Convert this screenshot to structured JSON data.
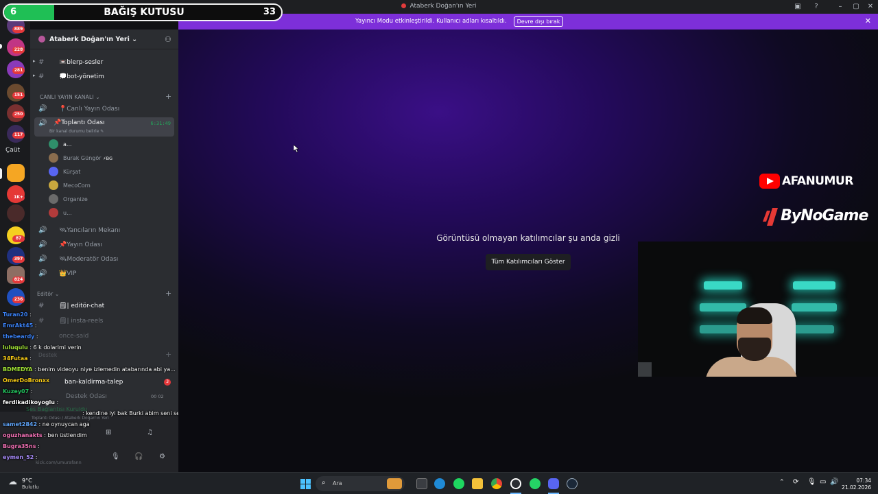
{
  "window": {
    "title": "Ataberk Doğan'ın Yeri"
  },
  "donation": {
    "left_value": "6",
    "title": "BAĞIŞ KUTUSU",
    "right_value": "33",
    "progress_fraction": 0.18
  },
  "banner": {
    "message": "Yayıncı Modu etkinleştirildi. Kullanıcı adları kısaltıldı.",
    "button": "Devre dışı bırak"
  },
  "rail": {
    "badges": [
      "889",
      "228",
      "281",
      "151",
      "250",
      "117",
      "1K+",
      "87",
      "397",
      "824",
      "236"
    ],
    "folder_label": "Çaüt"
  },
  "server": {
    "name": "Ataberk Doğan'ın Yeri ⌄"
  },
  "channels": {
    "text_top": [
      {
        "label": "blerp-sesler",
        "emoji": "📼"
      },
      {
        "label": "bot-yönetim",
        "emoji": "💭"
      }
    ],
    "category_live": "CANLI YAYIN KANALI ⌄",
    "voice_live": [
      {
        "label": "Canlı Yayın Odası",
        "emoji": "📍"
      }
    ],
    "active": {
      "label": "Toplantı Odası",
      "emoji": "📌",
      "timer": "6:31:49",
      "status": "Bir kanal durumu belirle ✎"
    },
    "voice_users": [
      {
        "name": "a...",
        "color": "#2f8f6a"
      },
      {
        "name": "Burak Güngör",
        "tag": "⚡BG",
        "color": "#8a6d4e"
      },
      {
        "name": "Kürşat",
        "color": "#5865f2"
      },
      {
        "name": "MecoCorn",
        "color": "#c8a73e"
      },
      {
        "name": "Organize",
        "color": "#6b6b6b"
      },
      {
        "name": "u...",
        "color": "#b23b3b"
      }
    ],
    "voice_more": [
      {
        "label": "Yancıların Mekanı",
        "emoji": "🛰"
      },
      {
        "label": "Yayın Odası",
        "emoji": "📌"
      },
      {
        "label": "Moderatör Odası",
        "emoji": "🛰"
      },
      {
        "label": "VIP",
        "emoji": "👑"
      }
    ],
    "category_editor": "Editör ⌄",
    "text_editor": [
      {
        "label": "| editör-chat",
        "emoji": "🗒"
      },
      {
        "label": "| insta-reels",
        "emoji": "🗒"
      },
      {
        "label": "once-said",
        "emoji": ""
      }
    ],
    "category_support": "Destek",
    "text_support": [
      {
        "label": "ban-kaldirma-talep",
        "badge": "3"
      },
      {
        "label": "Destek Odası",
        "counter": "00 02"
      }
    ],
    "voice_status": "Ses Bağlantısı Kuruldu",
    "voice_location": "Toplantı Odası / Ataberk Doğan'ın Yeri",
    "user_link": "kick.com/umurafann"
  },
  "chat": [
    {
      "user": "Turan20",
      "color": "#3b82f6",
      "text": ""
    },
    {
      "user": "EmrAkt45",
      "color": "#3b82f6",
      "text": ""
    },
    {
      "user": "thebeardy",
      "color": "#3b82f6",
      "text": ""
    },
    {
      "user": "luluqulu",
      "color": "#a3e635",
      "text": "6 k dolarimi verin"
    },
    {
      "user": "34Futaa",
      "color": "#facc15",
      "text": ""
    },
    {
      "user": "BDMEDYA",
      "color": "#a3e635",
      "text": "benim videoyu niye izlemedin atabarında abi ya..."
    },
    {
      "user": "OmerDoBronxx",
      "color": "#facc15",
      "text": ""
    },
    {
      "user": "Kuzey07",
      "color": "#22c55e",
      "text": ""
    },
    {
      "user": "ferdikadikoyoglu",
      "color": "#ffffff",
      "text": ""
    },
    {
      "user": "",
      "color": "#ef4444",
      "text": "kendine iyi bak Burki abim seni seviyoruz ❤"
    },
    {
      "user": "samet2842",
      "color": "#60a5fa",
      "text": "ne oynuycan aga"
    },
    {
      "user": "oguzhanakts",
      "color": "#f472b6",
      "text": "ben üstlendim"
    },
    {
      "user": "Bugra35ns",
      "color": "#f472b6",
      "text": ""
    },
    {
      "user": "eymen_52",
      "color": "#a78bfa",
      "text": ""
    }
  ],
  "stage": {
    "hidden_text": "Görüntüsü olmayan katılımcılar şu anda gizli",
    "show_button": "Tüm Katılımcıları Göster"
  },
  "brand": {
    "youtube_name": "AFANUMUR",
    "sponsor": "ByNoGame"
  },
  "taskbar": {
    "weather_temp": "9°C",
    "weather_desc": "Bulutlu",
    "search_label": "Ara",
    "time": "07:34",
    "date": "21.02.2026"
  }
}
